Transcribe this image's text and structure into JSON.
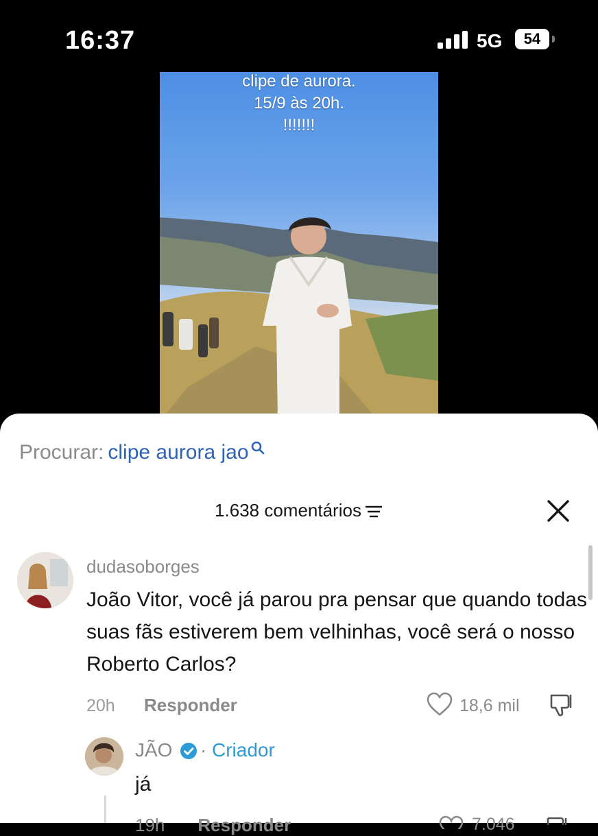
{
  "status_bar": {
    "time": "16:37",
    "network": "5G",
    "battery": "54"
  },
  "video": {
    "caption_lines": [
      "clipe de aurora.",
      "15/9 às 20h.",
      "!!!!!!!"
    ]
  },
  "search": {
    "prefix": "Procurar:",
    "query": "clipe aurora jao",
    "icon": "search-icon",
    "color": "#2f63b4"
  },
  "comments_header": {
    "count_label": "1.638 comentários",
    "filter_icon": "filter-icon",
    "close_icon": "close-icon"
  },
  "comments": [
    {
      "username": "dudasoborges",
      "text": "João Vitor, você já parou pra pensar que quando todas suas fãs estiverem bem velhinhas, você será o nosso Roberto Carlos?",
      "time": "20h",
      "reply_label": "Responder",
      "likes": "18,6 mil",
      "reply": {
        "username": "JÃO",
        "separator": "·",
        "badge_label": "Criador",
        "badge_color": "#2d9bd6",
        "text": "já",
        "time": "19h",
        "reply_label": "Responder",
        "likes": "7.046"
      }
    }
  ]
}
